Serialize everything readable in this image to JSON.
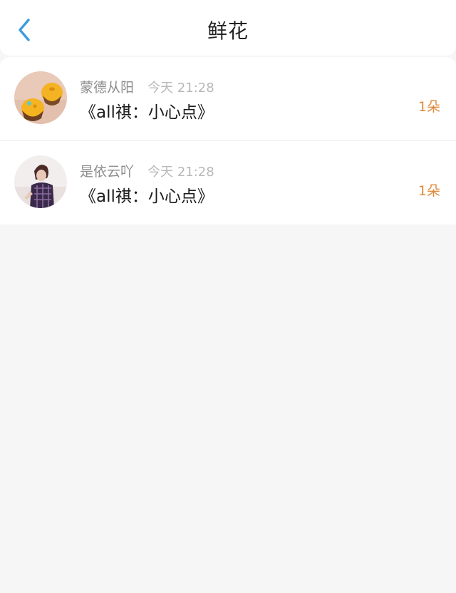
{
  "header": {
    "title": "鲜花",
    "back_icon": "chevron-left-icon",
    "accent_color": "#3a9be0"
  },
  "records": [
    {
      "username": "蒙德从阳",
      "time": "今天 21:28",
      "work_title": "《all祺：小心点》",
      "count": "1朵",
      "avatar": "cupcake-photo"
    },
    {
      "username": "是依云吖",
      "time": "今天 21:28",
      "work_title": "《all祺：小心点》",
      "count": "1朵",
      "avatar": "person-photo"
    }
  ],
  "colors": {
    "count": "#e0893a",
    "username": "#8d8d8d",
    "time": "#b8b8b8",
    "background": "#f7f6f7"
  }
}
